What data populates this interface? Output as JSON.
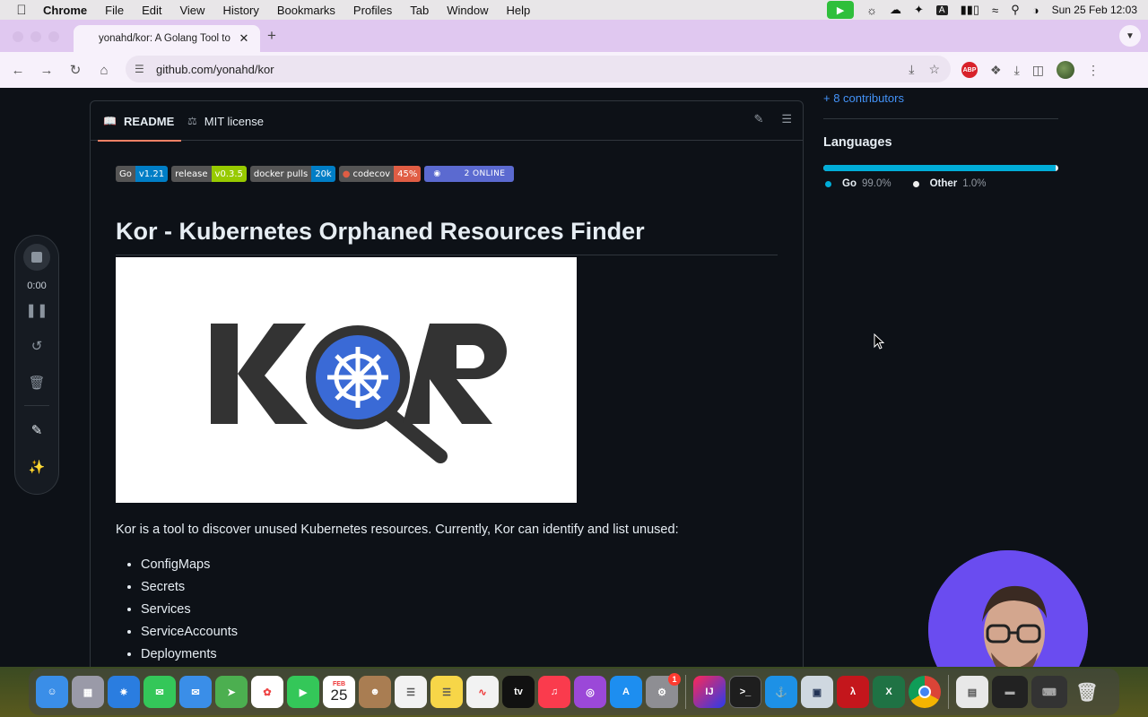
{
  "menubar": {
    "app": "Chrome",
    "items": [
      "File",
      "Edit",
      "View",
      "History",
      "Bookmarks",
      "Profiles",
      "Tab",
      "Window",
      "Help"
    ],
    "datetime": "Sun 25 Feb  12:03"
  },
  "browser": {
    "tab_title": "yonahd/kor: A Golang Tool to",
    "url": "github.com/yonahd/kor"
  },
  "readme": {
    "tab_readme": "README",
    "tab_license": "MIT license",
    "title": "Kor - Kubernetes Orphaned Resources Finder",
    "intro": "Kor is a tool to discover unused Kubernetes resources. Currently, Kor can identify and list unused:",
    "resources": [
      "ConfigMaps",
      "Secrets",
      "Services",
      "ServiceAccounts",
      "Deployments"
    ]
  },
  "badges": [
    {
      "label": "Go",
      "value": "v1.21",
      "color": "#007ec6"
    },
    {
      "label": "release",
      "value": "v0.3.5",
      "color": "#97ca00"
    },
    {
      "label": "docker pulls",
      "value": "20k",
      "color": "#007ec6"
    },
    {
      "label": "codecov",
      "value": "45%",
      "color": "#e05d44"
    }
  ],
  "discord_badge": "2 ONLINE",
  "sidebar": {
    "contributors_link": "+ 8 contributors",
    "languages_heading": "Languages",
    "languages": [
      {
        "name": "Go",
        "percent": "99.0%",
        "share": 99.0,
        "color": "#00ADD8"
      },
      {
        "name": "Other",
        "percent": "1.0%",
        "share": 1.0,
        "color": "#EDEDED"
      }
    ]
  },
  "recorder": {
    "elapsed": "0:00"
  },
  "dock": {
    "calendar_month": "FEB",
    "calendar_day": "25",
    "settings_badge": "1"
  }
}
